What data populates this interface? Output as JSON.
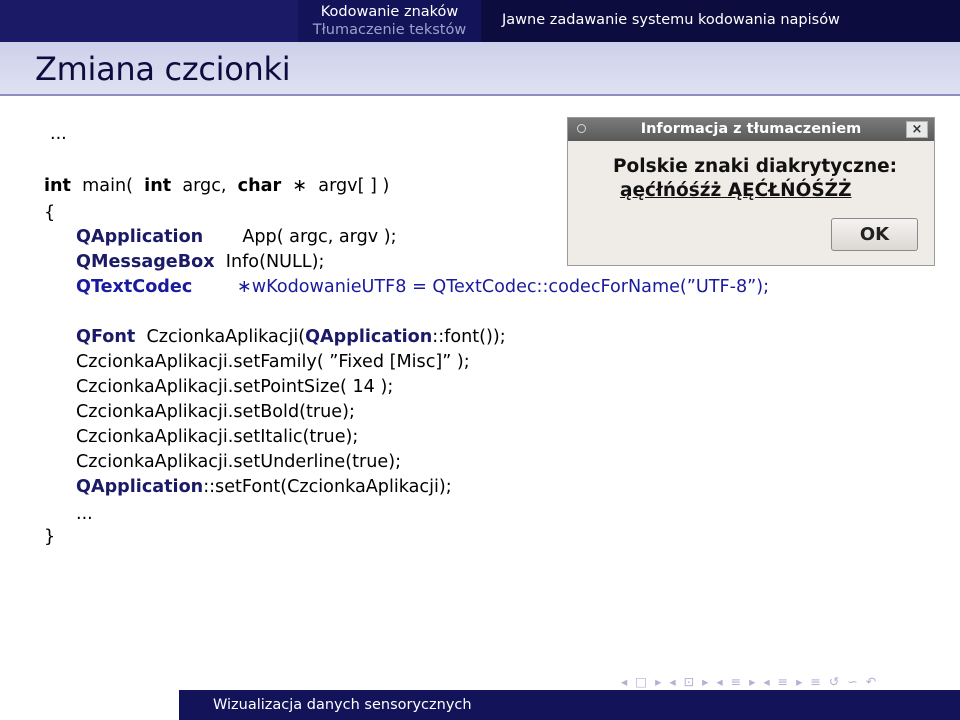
{
  "header": {
    "section_line1": "Kodowanie znaków",
    "section_line2": "Tłumaczenie tekstów",
    "subsection": "Jawne zadawanie systemu kodowania napisów"
  },
  "slide": {
    "title": "Zmiana czcionki"
  },
  "code": {
    "lines": [
      "...",
      "int main( int argc, char ∗ argv[ ] )",
      "{",
      "QApplication    App( argc, argv );",
      "QMessageBox Info(NULL);",
      "QTextCodec     ∗wKodowanieUTF8 = QTextCodec::codecForName(”UTF-8”);",
      "QFont CzcionkaAplikacji(QApplication::font());",
      "CzcionkaAplikacji.setFamily( ”Fixed [Misc]” );",
      "CzcionkaAplikacji.setPointSize( 14 );",
      "CzcionkaAplikacji.setBold(true);",
      "CzcionkaAplikacji.setItalic(true);",
      "CzcionkaAplikacji.setUnderline(true);",
      "QApplication::setFont(CzcionkaAplikacji);",
      "...",
      "}"
    ]
  },
  "dialog": {
    "title": "Informacja z tłumaczeniem",
    "close_symbol": "×",
    "text_line1": "Polskie znaki diakrytyczne:",
    "text_line2": "ąęćłńóśźż ĄĘĆŁŃÓŚŹŻ",
    "ok_label": "OK"
  },
  "nav_symbols": [
    "◂",
    "□",
    "▸",
    "◂",
    "⊡",
    "▸",
    "◂",
    "≡",
    "▸",
    "◂",
    "≡",
    "▸",
    "≡",
    "↺",
    "∽",
    "↶"
  ],
  "footer": {
    "text": "Wizualizacja danych sensorycznych"
  },
  "colors": {
    "dark_navy": "#0c0c3f",
    "navy": "#1a1a66",
    "code_blue": "#1a1a9e",
    "title_bg": "#d8daf0"
  }
}
